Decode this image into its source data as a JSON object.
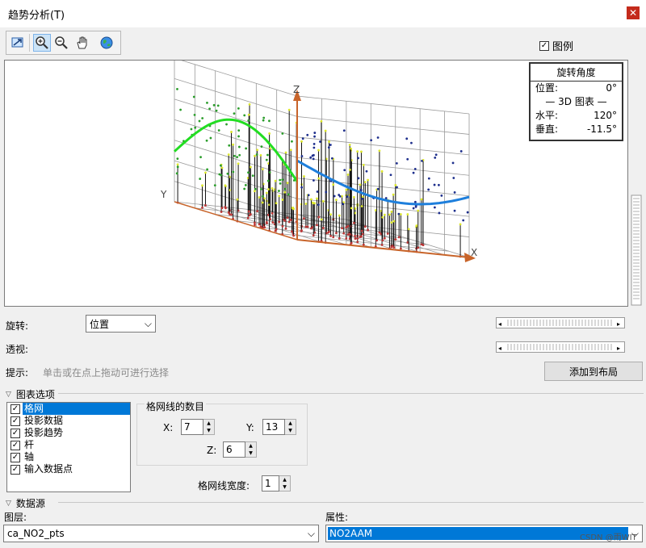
{
  "window": {
    "title": "趋势分析(T)",
    "close_glyph": "✕"
  },
  "toolbar": {
    "items": [
      "full-extent",
      "zoom-in",
      "zoom-out",
      "pan",
      "globe"
    ]
  },
  "legend_toggle": {
    "label": "图例",
    "checked": true
  },
  "rotation_box": {
    "title": "旋转角度",
    "position_label": "位置:",
    "position_value": "0°",
    "section": "— 3D 图表 —",
    "horizontal_label": "水平:",
    "horizontal_value": "120°",
    "vertical_label": "垂直:",
    "vertical_value": "-11.5°"
  },
  "axes": {
    "x": "X",
    "y": "Y",
    "z": "Z"
  },
  "controls": {
    "rotate_label": "旋转:",
    "rotate_value": "位置",
    "perspective_label": "透视:",
    "hint_label": "提示:",
    "hint_text": "单击或在点上拖动可进行选择",
    "add_to_layout": "添加到布局"
  },
  "chart_options": {
    "header": "图表选项",
    "items": [
      {
        "label": "格网",
        "checked": true,
        "selected": true
      },
      {
        "label": "投影数据",
        "checked": true,
        "selected": false
      },
      {
        "label": "投影趋势",
        "checked": true,
        "selected": false
      },
      {
        "label": "杆",
        "checked": true,
        "selected": false
      },
      {
        "label": "轴",
        "checked": true,
        "selected": false
      },
      {
        "label": "输入数据点",
        "checked": true,
        "selected": false
      }
    ],
    "grid_count_title": "格网线的数目",
    "x_label": "X:",
    "x_value": "7",
    "y_label": "Y:",
    "y_value": "13",
    "z_label": "Z:",
    "z_value": "6",
    "grid_width_label": "格网线宽度:",
    "grid_width_value": "1"
  },
  "data_source": {
    "header": "数据源",
    "layer_label": "图层:",
    "layer_value": "ca_NO2_pts",
    "attribute_label": "属性:",
    "attribute_value": "NO2AAM"
  },
  "watermark": "CSDN @雨WIT",
  "colors": {
    "grid": "#9a9a9a",
    "axis": "#c8642a",
    "green_trend": "#22dd22",
    "blue_trend": "#1e7fdc",
    "stem": "#111111"
  }
}
